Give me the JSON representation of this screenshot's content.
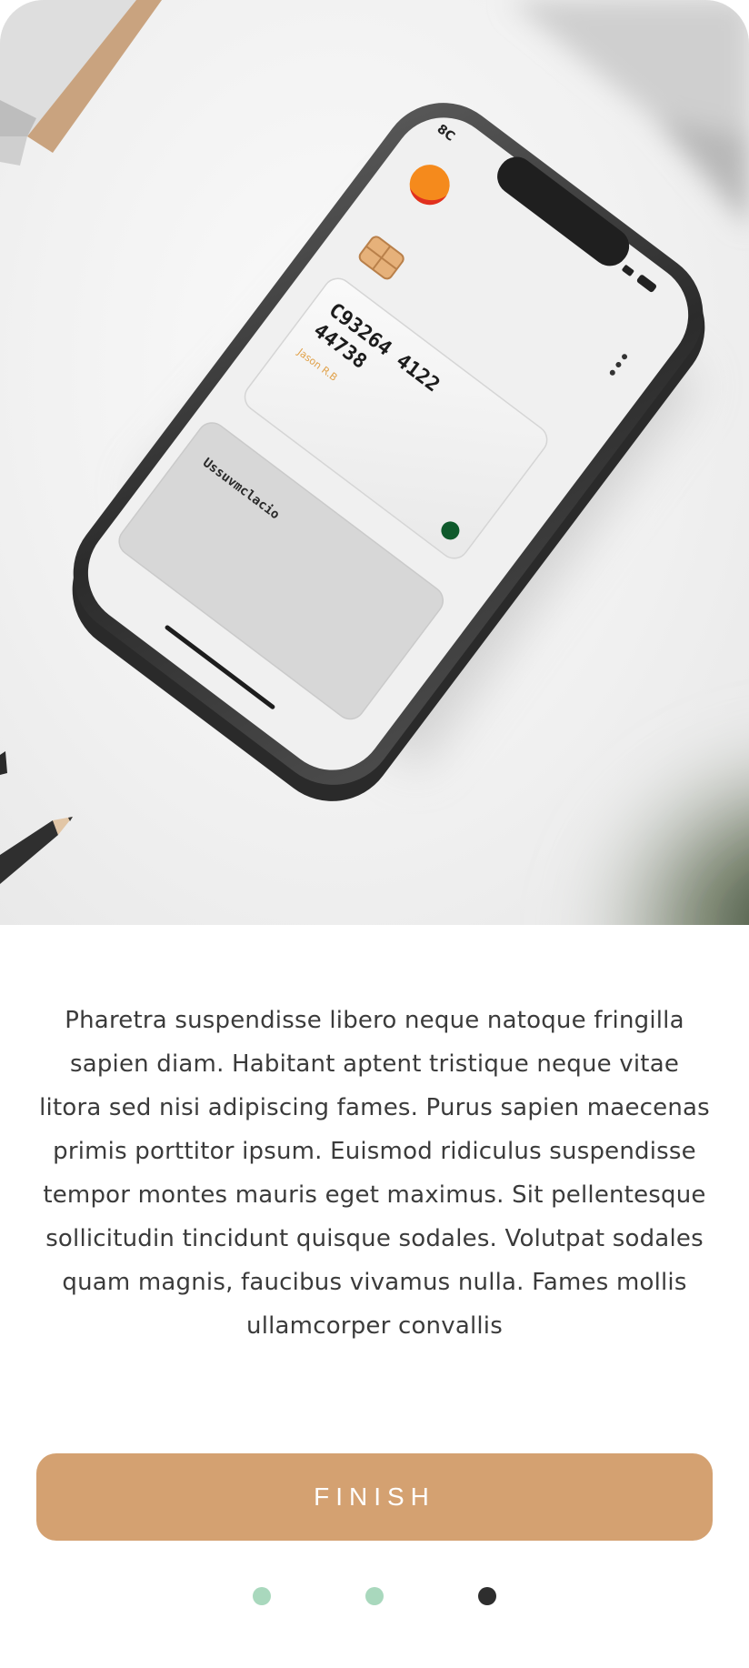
{
  "hero": {
    "phone_time": "8C",
    "card_number_line1": "C93264 4122",
    "card_number_line2": "44738",
    "card_small_text": "Jason R.B",
    "second_card_text": "Ussuvmclacio"
  },
  "onboarding": {
    "description": "Pharetra suspendisse libero neque natoque fringilla sapien diam. Habitant aptent tristique neque vitae litora sed nisi adipiscing fames. Purus sapien maecenas primis porttitor ipsum. Euismod ridiculus suspendisse tempor montes mauris eget maximus. Sit pellentesque sollicitudin tincidunt quisque sodales. Volutpat sodales quam magnis, faucibus vivamus nulla. Fames mollis ullamcorper convallis",
    "finish_label": "FINISH"
  },
  "pager": {
    "total": 3,
    "active_index": 3
  },
  "colors": {
    "accent": "#d4a171",
    "dot_inactive": "#a9d8bd",
    "dot_active": "#2e2e2e",
    "text": "#3b3b3b"
  }
}
